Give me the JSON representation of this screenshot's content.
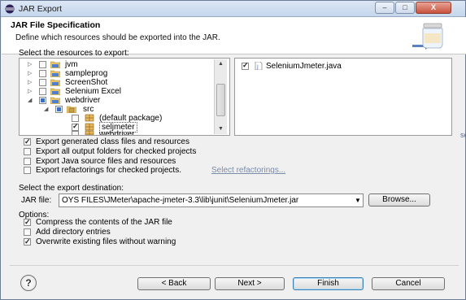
{
  "window": {
    "title": "JAR Export",
    "min_label": "–",
    "max_label": "□",
    "close_label": "X"
  },
  "header": {
    "title": "JAR File Specification",
    "description": "Define which resources should be exported into the JAR."
  },
  "resources": {
    "label": "Select the resources to export:",
    "tree": [
      {
        "label": "jvm",
        "icon": "project-icon",
        "expander": "▷",
        "check": "none"
      },
      {
        "label": "sampleprog",
        "icon": "project-icon",
        "expander": "▷",
        "check": "none"
      },
      {
        "label": "ScreenShot",
        "icon": "project-icon",
        "expander": "▷",
        "check": "none"
      },
      {
        "label": "Selenium Excel",
        "icon": "project-icon",
        "expander": "▷",
        "check": "none"
      },
      {
        "label": "webdriver",
        "icon": "project-icon",
        "expander": "◢",
        "check": "partial"
      },
      {
        "label": "src",
        "icon": "source-folder-icon",
        "expander": "◢",
        "check": "partial"
      },
      {
        "label": "(default package)",
        "icon": "package-icon",
        "expander": "",
        "check": "none"
      },
      {
        "label": "seljmeter",
        "icon": "package-icon",
        "expander": "",
        "check": "checked"
      },
      {
        "label": "webdriver",
        "icon": "package-icon",
        "expander": "",
        "check": "none"
      }
    ],
    "files": [
      {
        "label": "SeleniumJmeter.java",
        "icon": "java-file-icon",
        "check": "checked"
      }
    ]
  },
  "export_options": [
    {
      "label": "Export generated class files and resources",
      "checked": true
    },
    {
      "label": "Export all output folders for checked projects",
      "checked": false
    },
    {
      "label": "Export Java source files and resources",
      "checked": false
    },
    {
      "label": "Export refactorings for checked projects.",
      "checked": false
    }
  ],
  "refactorings_link": "Select refactorings...",
  "destination": {
    "label": "Select the export destination:",
    "jar_label": "JAR file:",
    "jar_value": "OYS FILES\\JMeter\\apache-jmeter-3.3\\lib\\junit\\SeleniumJmeter.jar",
    "browse_label": "Browse..."
  },
  "options": {
    "label": "Options:",
    "items": [
      {
        "label": "Compress the contents of the JAR file",
        "checked": true
      },
      {
        "label": "Add directory entries",
        "checked": false
      },
      {
        "label": "Overwrite existing files without warning",
        "checked": true
      }
    ]
  },
  "buttons": {
    "help": "?",
    "back": "< Back",
    "next": "Next >",
    "finish": "Finish",
    "cancel": "Cancel"
  },
  "edge_text": "se",
  "colors": {
    "link": "#7b8ba8",
    "partial_check": "#3a6fc2",
    "default_button_border": "#3c7fb1"
  }
}
